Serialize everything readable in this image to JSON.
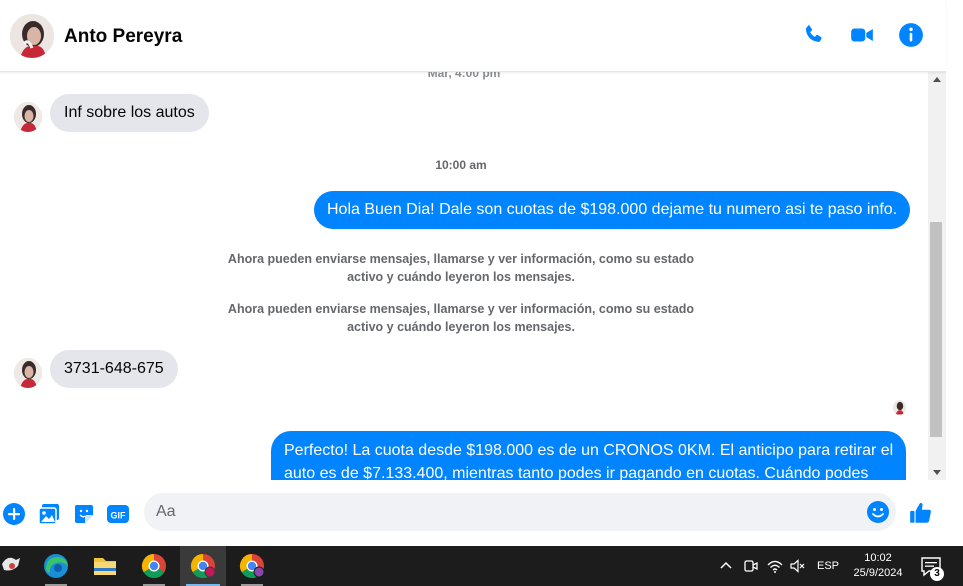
{
  "header": {
    "contact_name": "Anto Pereyra"
  },
  "messages": {
    "faded_timestamp": "Mar, 4:00 pm",
    "incoming_1": "Inf sobre los autos",
    "time_separator": "10:00 am",
    "outgoing_1": "Hola Buen Dia! Dale son cuotas de $198.000 dejame tu numero asi te paso info.",
    "system_note_1": "Ahora pueden enviarse mensajes, llamarse y ver información, como su estado activo y cuándo leyeron los mensajes.",
    "system_note_2": "Ahora pueden enviarse mensajes, llamarse y ver información, como su estado activo y cuándo leyeron los mensajes.",
    "incoming_2": "3731-648-675",
    "outgoing_2_line1": "Perfecto! La cuota desde $198.000 es de un CRONOS 0KM. El anticipo para retirar el",
    "outgoing_2_line2": "auto es de $7.133.400, mientras tanto podes ir pagando en cuotas. Cuándo podes"
  },
  "composer": {
    "placeholder": "Aa"
  },
  "taskbar": {
    "language": "ESP",
    "time": "10:02",
    "date": "25/9/2024",
    "notification_count": "3"
  },
  "colors": {
    "accent": "#0084ff",
    "incoming_bubble": "#e4e6eb"
  }
}
